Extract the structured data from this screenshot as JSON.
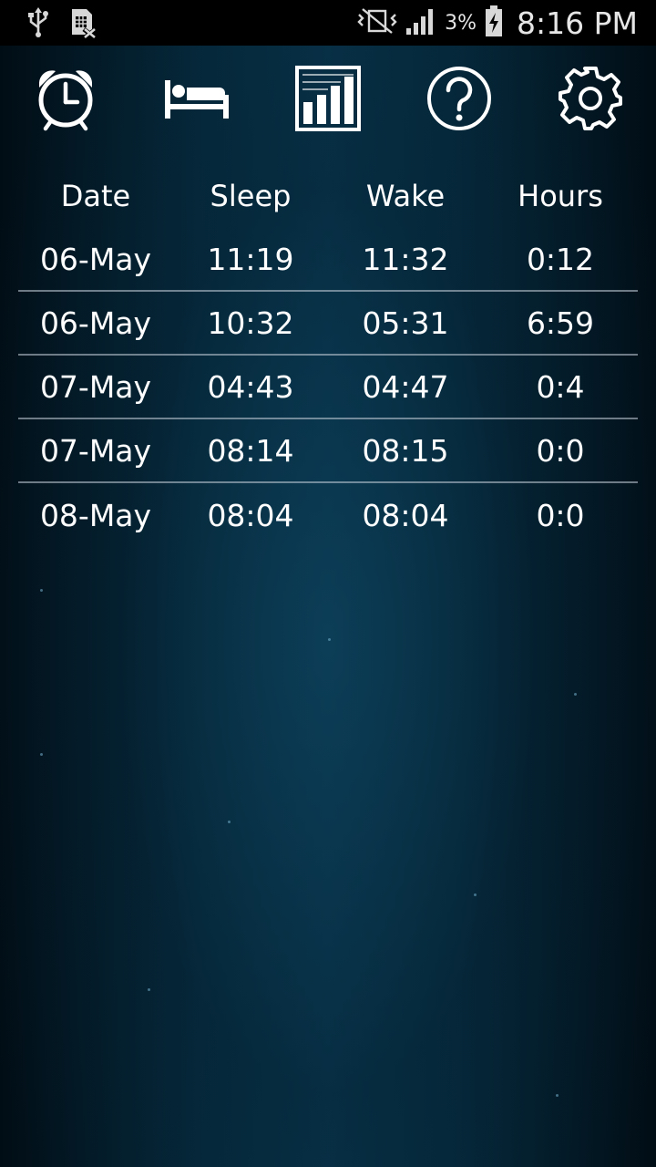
{
  "status_bar": {
    "time": "8:16 PM",
    "battery_percent": "3%",
    "icons": [
      "usb-icon",
      "sim-error-icon",
      "vibrate-off-icon",
      "signal-icon",
      "battery-charging-icon"
    ]
  },
  "toolbar": {
    "items": [
      {
        "name": "alarm-clock-icon"
      },
      {
        "name": "bed-icon"
      },
      {
        "name": "chart-icon"
      },
      {
        "name": "help-icon"
      },
      {
        "name": "settings-icon"
      }
    ]
  },
  "table": {
    "headers": [
      "Date",
      "Sleep",
      "Wake",
      "Hours"
    ],
    "rows": [
      [
        "06-May",
        "11:19",
        "11:32",
        "0:12"
      ],
      [
        "06-May",
        "10:32",
        "05:31",
        "6:59"
      ],
      [
        "07-May",
        "04:43",
        "04:47",
        "0:4"
      ],
      [
        "07-May",
        "08:14",
        "08:15",
        "0:0"
      ],
      [
        "08-May",
        "08:04",
        "08:04",
        "0:0"
      ]
    ]
  },
  "colors": {
    "background": "#062a3d",
    "status_bar": "#000000",
    "text": "#ffffff",
    "divider": "#c8d2dc"
  }
}
